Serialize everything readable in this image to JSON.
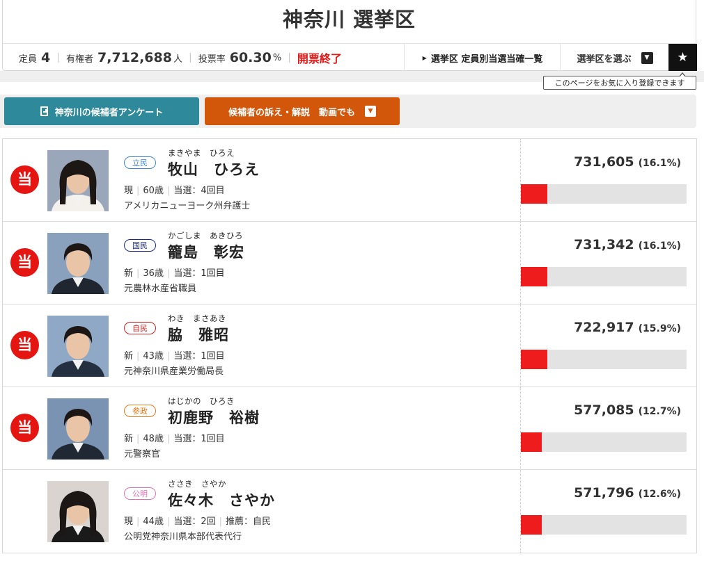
{
  "district": {
    "title": "神奈川 選挙区",
    "seats_label": "定員",
    "seats": "4",
    "voters_label": "有権者",
    "voters": "7,712,688",
    "voters_unit": "人",
    "turnout_label": "投票率",
    "turnout": "60.30",
    "turnout_unit": "%",
    "status": "開票終了"
  },
  "nav": {
    "winners_link": "選挙区 定員別当選当確一覧",
    "select_district": "選挙区を選ぶ",
    "favorite_tooltip": "このページをお気に入り登録できます"
  },
  "buttons": {
    "survey": "神奈川の候補者アンケート",
    "videos": "候補者の訴え・解説　動画でも"
  },
  "colors": {
    "win": "#e51512",
    "bar_fill": "#ee1c1c",
    "survey_btn": "#2e8a9a",
    "video_btn": "#d3570b"
  },
  "candidates": [
    {
      "elected": true,
      "elected_mark": "当",
      "party": "立民",
      "party_color": "#3a86d8",
      "kana": "まきやま　ひろえ",
      "name": "牧山　ひろえ",
      "status": "現",
      "age": "60歳",
      "wins": "当選：4回目",
      "endorse": "",
      "career": "アメリカニューヨーク州弁護士",
      "votes": "731,605",
      "pct": "(16.1%)",
      "share": 16.1
    },
    {
      "elected": true,
      "elected_mark": "当",
      "party": "国民",
      "party_color": "#1a2a8a",
      "kana": "かごしま　あきひろ",
      "name": "籠島　彰宏",
      "status": "新",
      "age": "36歳",
      "wins": "当選：1回目",
      "endorse": "",
      "career": "元農林水産省職員",
      "votes": "731,342",
      "pct": "(16.1%)",
      "share": 16.1
    },
    {
      "elected": true,
      "elected_mark": "当",
      "party": "自民",
      "party_color": "#d42020",
      "kana": "わき　まさあき",
      "name": "脇　雅昭",
      "status": "新",
      "age": "43歳",
      "wins": "当選：1回目",
      "endorse": "",
      "career": "元神奈川県産業労働局長",
      "votes": "722,917",
      "pct": "(15.9%)",
      "share": 15.9
    },
    {
      "elected": true,
      "elected_mark": "当",
      "party": "参政",
      "party_color": "#e07a1a",
      "kana": "はじかの　ひろき",
      "name": "初鹿野　裕樹",
      "status": "新",
      "age": "48歳",
      "wins": "当選：1回目",
      "endorse": "",
      "career": "元警察官",
      "votes": "577,085",
      "pct": "(12.7%)",
      "share": 12.7
    },
    {
      "elected": false,
      "elected_mark": "",
      "party": "公明",
      "party_color": "#e070b8",
      "kana": "ささき　さやか",
      "name": "佐々木　さやか",
      "status": "現",
      "age": "44歳",
      "wins": "当選：2回",
      "endorse": "推薦：自民",
      "career": "公明党神奈川県本部代表代行",
      "votes": "571,796",
      "pct": "(12.6%)",
      "share": 12.6
    }
  ]
}
